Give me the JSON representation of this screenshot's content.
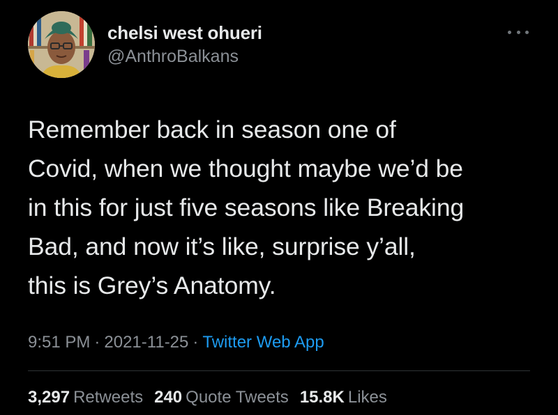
{
  "tweet": {
    "author": {
      "display_name": "chelsi west ohueri",
      "handle": "@AnthroBalkans"
    },
    "text_lines": [
      "Remember back in season one of",
      "Covid, when we thought maybe we’d be",
      "in this for just five seasons like Breaking",
      "Bad, and now it’s like, surprise y’all,",
      "this is Grey’s Anatomy."
    ],
    "meta": {
      "time": "9:51 PM",
      "separator": "·",
      "date": "2021-11-25",
      "source": "Twitter Web App"
    },
    "stats": {
      "retweets_count": "3,297",
      "retweets_label": "Retweets",
      "quote_count": "240",
      "quote_label": "Quote Tweets",
      "likes_count": "15.8K",
      "likes_label": "Likes"
    },
    "more_icon": "ellipsis-icon",
    "colors": {
      "background": "#000000",
      "text": "#e7e9ea",
      "secondary": "#8b9096",
      "link": "#1d9bf0"
    }
  }
}
